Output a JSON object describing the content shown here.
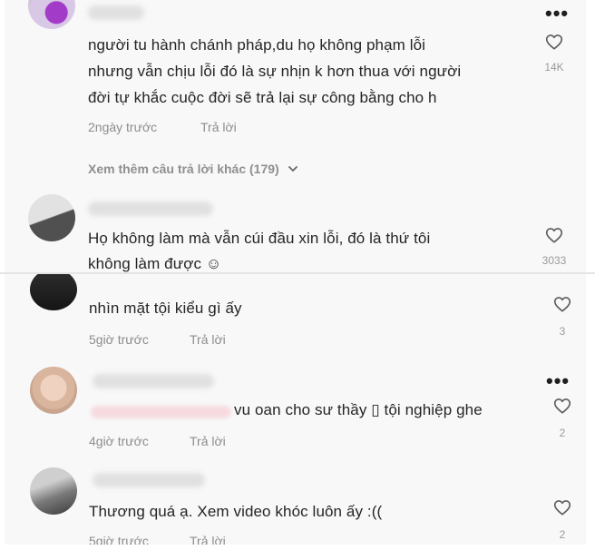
{
  "colors": {
    "background": "#f8f8f8",
    "text": "#252525",
    "muted": "#8d8d8d",
    "heart_outline": "#5c5c5c"
  },
  "icons": {
    "like": "heart-outline-icon",
    "more": "more-options-icon",
    "expand": "chevron-down-icon"
  },
  "comments": [
    {
      "text_lines": [
        "người tu hành chánh pháp,du họ không phạm lỗi",
        "nhưng vẫn chịu lỗi đó là sự nhịn k hơn thua với người",
        "đời tự khắc cuộc đời sẽ trả lại sự công bằng cho h"
      ],
      "time": "2ngày trước",
      "reply_label": "Trả lời",
      "likes": "14K",
      "more_replies": "Xem thêm câu trả lời khác (179)"
    },
    {
      "text_lines": [
        "Họ không làm mà vẫn cúi đầu xin lỗi, đó là thứ tôi",
        "không làm được ☺"
      ],
      "likes": "3033"
    },
    {
      "text": "nhìn mặt tội kiểu gì ấy",
      "time": "5giờ trước",
      "reply_label": "Trả lời",
      "likes": "3"
    },
    {
      "text": "vu oan cho sư thầy ▯ tội nghiệp ghe",
      "time": "4giờ trước",
      "reply_label": "Trả lời",
      "likes": "2"
    },
    {
      "text": "Thương quá ạ. Xem video khóc luôn ấy :((",
      "time": "5giờ trước",
      "reply_label": "Trả lời",
      "likes": "2"
    }
  ],
  "more_symbol": "•••"
}
